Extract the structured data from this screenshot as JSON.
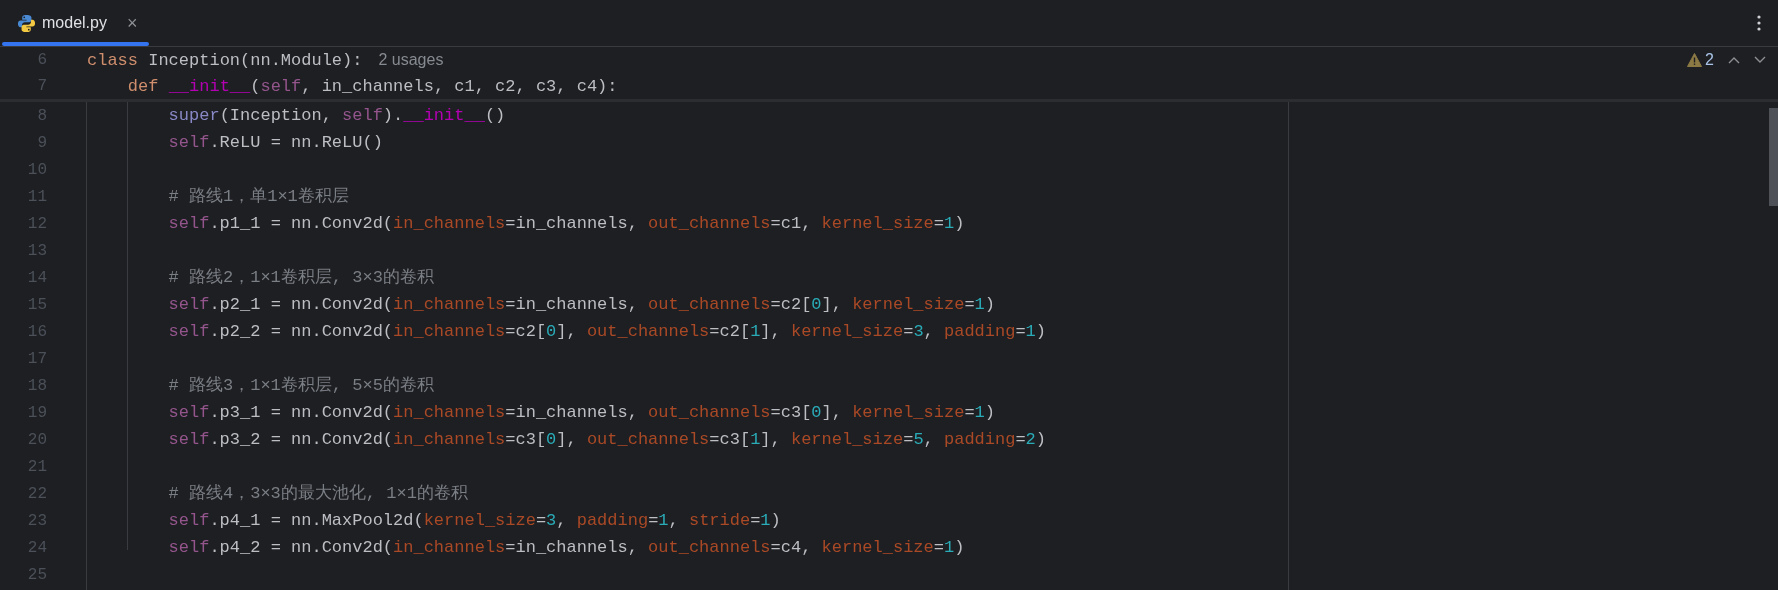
{
  "tabs": [
    {
      "label": "model.py",
      "selected": true,
      "close": "×"
    }
  ],
  "inspections": {
    "warnings": "2"
  },
  "sticky_lines": [
    {
      "number": "6",
      "tokens": [
        {
          "kind": "kw",
          "text": "class"
        },
        {
          "kind": "tx",
          "text": " Inception(nn.Module):"
        }
      ],
      "hint": "2 usages"
    },
    {
      "number": "7",
      "tokens": [
        {
          "kind": "kw",
          "text": "    def "
        },
        {
          "kind": "magic",
          "text": "__init__"
        },
        {
          "kind": "tx",
          "text": "("
        },
        {
          "kind": "self",
          "text": "self"
        },
        {
          "kind": "tx",
          "text": ", in_channels, c1, c2, c3, c4):"
        }
      ]
    }
  ],
  "lines": [
    {
      "number": "8",
      "tokens": [
        {
          "kind": "builtin",
          "text": "        super"
        },
        {
          "kind": "tx",
          "text": "(Inception, "
        },
        {
          "kind": "self",
          "text": "self"
        },
        {
          "kind": "tx",
          "text": ")."
        },
        {
          "kind": "magic",
          "text": "__init__"
        },
        {
          "kind": "tx",
          "text": "()"
        }
      ]
    },
    {
      "number": "9",
      "tokens": [
        {
          "kind": "self",
          "text": "        self"
        },
        {
          "kind": "tx",
          "text": ".ReLU = nn.ReLU()"
        }
      ]
    },
    {
      "number": "10"
    },
    {
      "number": "11",
      "tokens": [
        {
          "kind": "cm",
          "text": "        # 路线1，单1×1卷积层"
        }
      ]
    },
    {
      "number": "12",
      "tokens": [
        {
          "kind": "self",
          "text": "        self"
        },
        {
          "kind": "tx",
          "text": ".p1_1 = nn.Conv2d("
        },
        {
          "kind": "arg",
          "text": "in_channels"
        },
        {
          "kind": "tx",
          "text": "=in_channels, "
        },
        {
          "kind": "arg",
          "text": "out_channels"
        },
        {
          "kind": "tx",
          "text": "=c1, "
        },
        {
          "kind": "arg",
          "text": "kernel_size"
        },
        {
          "kind": "tx",
          "text": "="
        },
        {
          "kind": "num",
          "text": "1"
        },
        {
          "kind": "tx",
          "text": ")"
        }
      ]
    },
    {
      "number": "13"
    },
    {
      "number": "14",
      "tokens": [
        {
          "kind": "cm",
          "text": "        # 路线2，1×1卷积层, 3×3的卷积"
        }
      ]
    },
    {
      "number": "15",
      "tokens": [
        {
          "kind": "self",
          "text": "        self"
        },
        {
          "kind": "tx",
          "text": ".p2_1 = nn.Conv2d("
        },
        {
          "kind": "arg",
          "text": "in_channels"
        },
        {
          "kind": "tx",
          "text": "=in_channels, "
        },
        {
          "kind": "arg",
          "text": "out_channels"
        },
        {
          "kind": "tx",
          "text": "=c2["
        },
        {
          "kind": "num",
          "text": "0"
        },
        {
          "kind": "tx",
          "text": "], "
        },
        {
          "kind": "arg",
          "text": "kernel_size"
        },
        {
          "kind": "tx",
          "text": "="
        },
        {
          "kind": "num",
          "text": "1"
        },
        {
          "kind": "tx",
          "text": ")"
        }
      ]
    },
    {
      "number": "16",
      "tokens": [
        {
          "kind": "self",
          "text": "        self"
        },
        {
          "kind": "tx",
          "text": ".p2_2 = nn.Conv2d("
        },
        {
          "kind": "arg",
          "text": "in_channels"
        },
        {
          "kind": "tx",
          "text": "=c2["
        },
        {
          "kind": "num",
          "text": "0"
        },
        {
          "kind": "tx",
          "text": "], "
        },
        {
          "kind": "arg",
          "text": "out_channels"
        },
        {
          "kind": "tx",
          "text": "=c2["
        },
        {
          "kind": "num",
          "text": "1"
        },
        {
          "kind": "tx",
          "text": "], "
        },
        {
          "kind": "arg",
          "text": "kernel_size"
        },
        {
          "kind": "tx",
          "text": "="
        },
        {
          "kind": "num",
          "text": "3"
        },
        {
          "kind": "tx",
          "text": ", "
        },
        {
          "kind": "arg",
          "text": "padding"
        },
        {
          "kind": "tx",
          "text": "="
        },
        {
          "kind": "num",
          "text": "1"
        },
        {
          "kind": "tx",
          "text": ")"
        }
      ]
    },
    {
      "number": "17"
    },
    {
      "number": "18",
      "tokens": [
        {
          "kind": "cm",
          "text": "        # 路线3，1×1卷积层, 5×5的卷积"
        }
      ]
    },
    {
      "number": "19",
      "tokens": [
        {
          "kind": "self",
          "text": "        self"
        },
        {
          "kind": "tx",
          "text": ".p3_1 = nn.Conv2d("
        },
        {
          "kind": "arg",
          "text": "in_channels"
        },
        {
          "kind": "tx",
          "text": "=in_channels, "
        },
        {
          "kind": "arg",
          "text": "out_channels"
        },
        {
          "kind": "tx",
          "text": "=c3["
        },
        {
          "kind": "num",
          "text": "0"
        },
        {
          "kind": "tx",
          "text": "], "
        },
        {
          "kind": "arg",
          "text": "kernel_size"
        },
        {
          "kind": "tx",
          "text": "="
        },
        {
          "kind": "num",
          "text": "1"
        },
        {
          "kind": "tx",
          "text": ")"
        }
      ]
    },
    {
      "number": "20",
      "tokens": [
        {
          "kind": "self",
          "text": "        self"
        },
        {
          "kind": "tx",
          "text": ".p3_2 = nn.Conv2d("
        },
        {
          "kind": "arg",
          "text": "in_channels"
        },
        {
          "kind": "tx",
          "text": "=c3["
        },
        {
          "kind": "num",
          "text": "0"
        },
        {
          "kind": "tx",
          "text": "], "
        },
        {
          "kind": "arg",
          "text": "out_channels"
        },
        {
          "kind": "tx",
          "text": "=c3["
        },
        {
          "kind": "num",
          "text": "1"
        },
        {
          "kind": "tx",
          "text": "], "
        },
        {
          "kind": "arg",
          "text": "kernel_size"
        },
        {
          "kind": "tx",
          "text": "="
        },
        {
          "kind": "num",
          "text": "5"
        },
        {
          "kind": "tx",
          "text": ", "
        },
        {
          "kind": "arg",
          "text": "padding"
        },
        {
          "kind": "tx",
          "text": "="
        },
        {
          "kind": "num",
          "text": "2"
        },
        {
          "kind": "tx",
          "text": ")"
        }
      ]
    },
    {
      "number": "21"
    },
    {
      "number": "22",
      "tokens": [
        {
          "kind": "cm",
          "text": "        # 路线4，3×3的最大池化, 1×1的卷积"
        }
      ]
    },
    {
      "number": "23",
      "tokens": [
        {
          "kind": "self",
          "text": "        self"
        },
        {
          "kind": "tx",
          "text": ".p4_1 = nn.MaxPool2d("
        },
        {
          "kind": "arg",
          "text": "kernel_size"
        },
        {
          "kind": "tx",
          "text": "="
        },
        {
          "kind": "num",
          "text": "3"
        },
        {
          "kind": "tx",
          "text": ", "
        },
        {
          "kind": "arg",
          "text": "padding"
        },
        {
          "kind": "tx",
          "text": "="
        },
        {
          "kind": "num",
          "text": "1"
        },
        {
          "kind": "tx",
          "text": ", "
        },
        {
          "kind": "arg",
          "text": "stride"
        },
        {
          "kind": "tx",
          "text": "="
        },
        {
          "kind": "num",
          "text": "1"
        },
        {
          "kind": "tx",
          "text": ")"
        }
      ]
    },
    {
      "number": "24",
      "tokens": [
        {
          "kind": "self",
          "text": "        self"
        },
        {
          "kind": "tx",
          "text": ".p4_2 = nn.Conv2d("
        },
        {
          "kind": "arg",
          "text": "in_channels"
        },
        {
          "kind": "tx",
          "text": "=in_channels, "
        },
        {
          "kind": "arg",
          "text": "out_channels"
        },
        {
          "kind": "tx",
          "text": "=c4, "
        },
        {
          "kind": "arg",
          "text": "kernel_size"
        },
        {
          "kind": "tx",
          "text": "="
        },
        {
          "kind": "num",
          "text": "1"
        },
        {
          "kind": "tx",
          "text": ")"
        }
      ]
    },
    {
      "number": "25"
    }
  ]
}
